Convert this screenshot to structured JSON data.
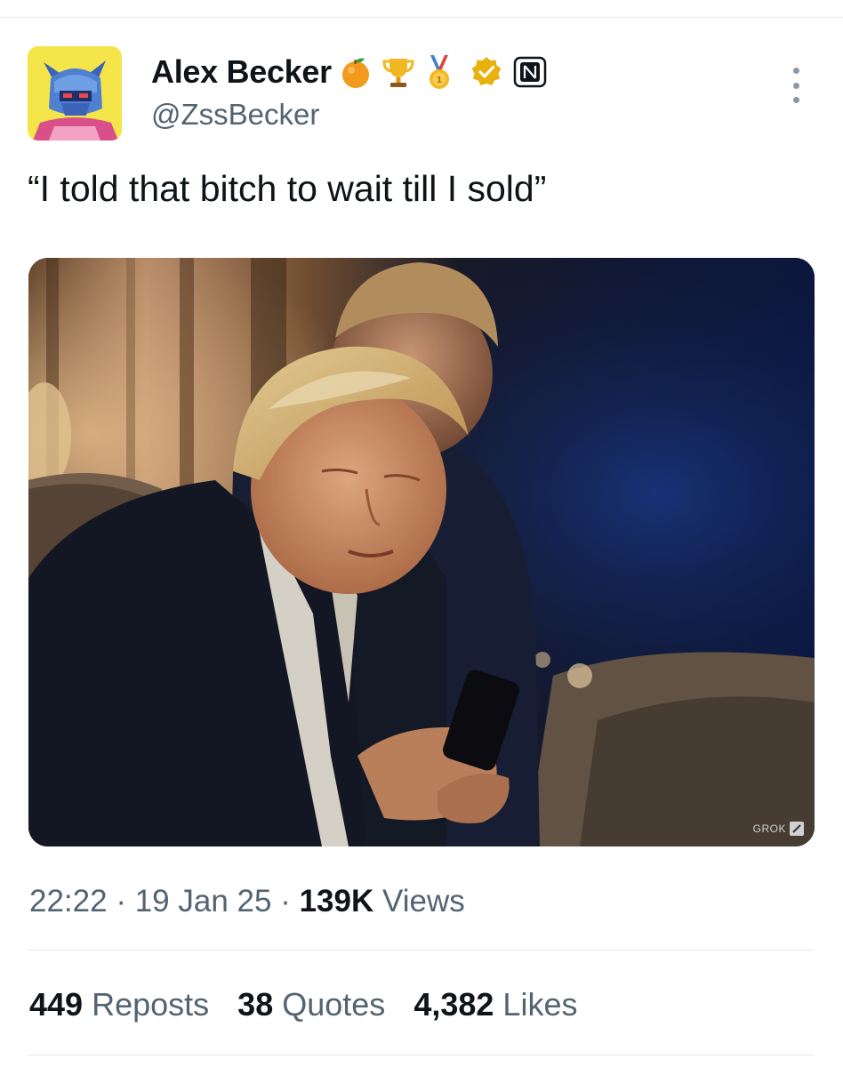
{
  "author": {
    "display_name": "Alex Becker",
    "handle": "@ZssBecker",
    "badges": [
      "orange-emoji-icon",
      "trophy-emoji-icon",
      "gold-medal-emoji-icon",
      "verified-badge-icon",
      "affiliate-badge-icon"
    ]
  },
  "tweet": {
    "text": "“I told that bitch to wait till I sold”",
    "media_watermark": "GROK",
    "time": "22:22",
    "separator": "·",
    "date": "19 Jan 25",
    "views_count": "139K",
    "views_label": "Views"
  },
  "stats": {
    "reposts_count": "449",
    "reposts_label": "Reposts",
    "quotes_count": "38",
    "quotes_label": "Quotes",
    "likes_count": "4,382",
    "likes_label": "Likes"
  },
  "colors": {
    "text_primary": "#0f1419",
    "text_secondary": "#536471",
    "divider": "#e3e6e8",
    "verified_gold": "#e8b10e"
  }
}
